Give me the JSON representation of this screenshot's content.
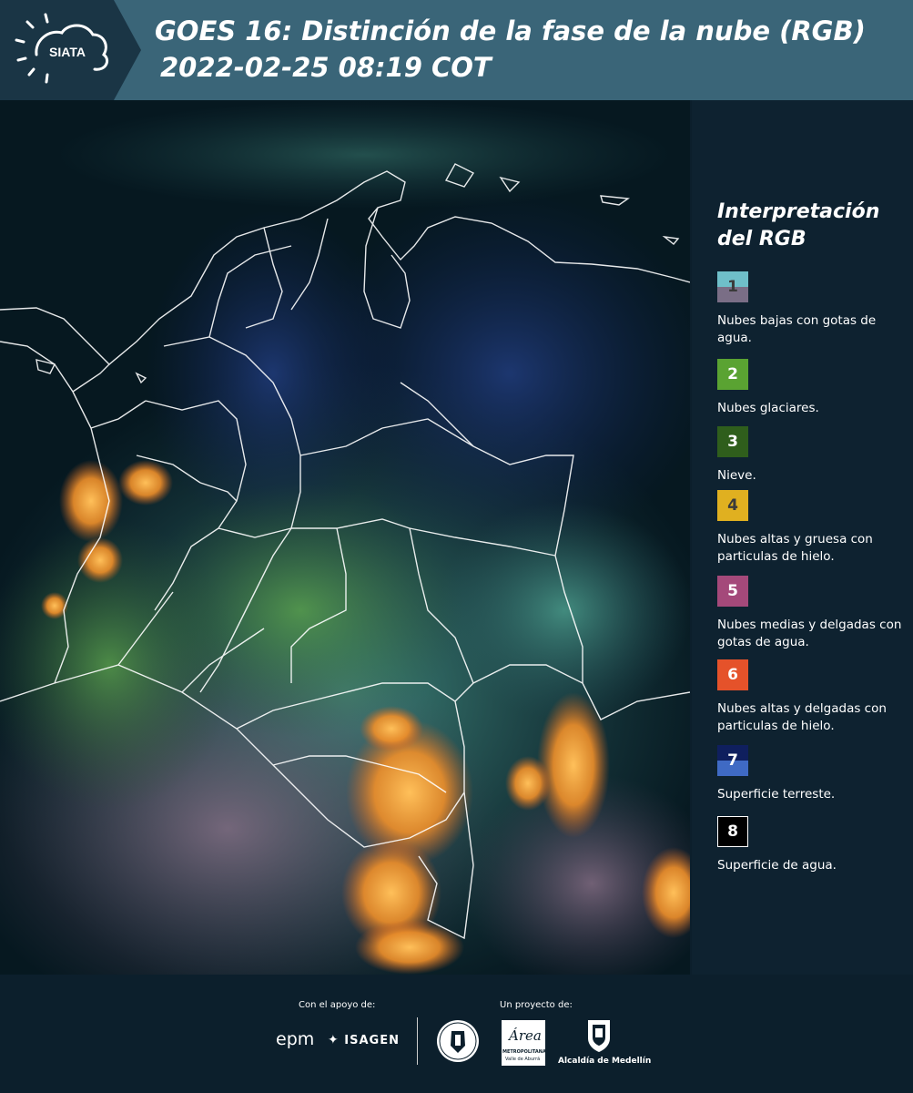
{
  "header": {
    "logo_text": "SIATA",
    "title_line1": "GOES 16: Distinción de la fase de la nube (RGB)",
    "title_line2": "2022-02-25 08:19 COT"
  },
  "legend": {
    "title": "Interpretación del RGB",
    "items": [
      {
        "number": "1",
        "description": "Nubes bajas con gotas de agua.",
        "color_top": "#6fbfc9",
        "color_bottom": "#7a6e86",
        "text_color": "#3a3a3a"
      },
      {
        "number": "2",
        "description": "Nubes glaciares.",
        "color_top": "#5aa332",
        "color_bottom": "#5aa332",
        "text_color": "#ffffff"
      },
      {
        "number": "3",
        "description": "Nieve.",
        "color_top": "#2f5e1c",
        "color_bottom": "#2f5e1c",
        "text_color": "#ffffff"
      },
      {
        "number": "4",
        "description": "Nubes altas y gruesa con particulas de hielo.",
        "color_top": "#e0b020",
        "color_bottom": "#e0b020",
        "text_color": "#3a3a3a"
      },
      {
        "number": "5",
        "description": "Nubes medias y delgadas con gotas de agua.",
        "color_top": "#a4497a",
        "color_bottom": "#a4497a",
        "text_color": "#ffffff"
      },
      {
        "number": "6",
        "description": "Nubes altas y delgadas con particulas de hielo.",
        "color_top": "#e5522a",
        "color_bottom": "#e5522a",
        "text_color": "#ffffff"
      },
      {
        "number": "7",
        "description": "Superficie terreste.",
        "color_top": "#0f1f5e",
        "color_bottom": "#3f6ac4",
        "text_color": "#ffffff"
      },
      {
        "number": "8",
        "description": "Superficie de agua.",
        "color_top": "#000000",
        "color_bottom": "#000000",
        "text_color": "#ffffff"
      }
    ]
  },
  "footer": {
    "support_label": "Con el apoyo de:",
    "project_label": "Un proyecto de:",
    "epm_label": "epm",
    "isagen_label": "ISAGEN",
    "area_label": "Área",
    "area_sub1": "METROPOLITANA",
    "area_sub2": "Valle de Aburrá",
    "alcaldia_label": "Alcaldía de Medellín"
  }
}
